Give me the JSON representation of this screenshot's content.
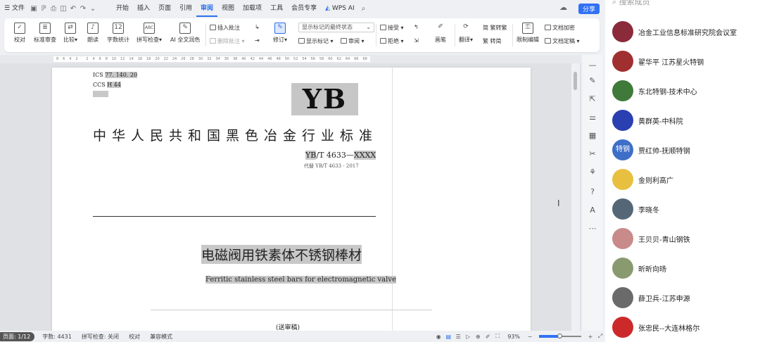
{
  "menubar": {
    "file": "文件",
    "undo_label": "↶",
    "tabs": [
      "开始",
      "插入",
      "页面",
      "引用",
      "审阅",
      "视图",
      "加载项",
      "工具",
      "会员专享"
    ],
    "active_tab": "审阅",
    "wps_ai": "WPS AI",
    "share": "分享"
  },
  "ribbon": {
    "proofread": "校对",
    "std_review": "标准审查",
    "compare": "比较",
    "read_aloud": "朗读",
    "word_count": "字数统计",
    "spell_check": "拼写检查",
    "ai_polish": "AI 全文润色",
    "insert_comment": "插入批注",
    "delete_comment": "删除批注",
    "revise": "修订",
    "display_dropdown": "显示标记的最终状态",
    "show_marks": "显示标记",
    "review_pane": "审阅",
    "accept": "接受",
    "reject": "拒绝",
    "pen": "画笔",
    "translate": "翻译",
    "trad_simp": "简 繁转繁",
    "simp_trad": "繁 转简",
    "restrict": "限制编辑",
    "doc_encrypt": "文档加密",
    "doc_final": "文档定稿"
  },
  "ruler": {
    "ticks": [
      "8",
      "6",
      "4",
      "2",
      "",
      "2",
      "4",
      "6",
      "8",
      "10",
      "12",
      "14",
      "16",
      "18",
      "20",
      "22",
      "24",
      "26",
      "28",
      "30",
      "32",
      "34",
      "36",
      "38",
      "40",
      "42",
      "44",
      "46",
      "48",
      "50",
      "52",
      "54",
      "56",
      "58",
      "60",
      "62",
      "64",
      "66",
      "68"
    ]
  },
  "document": {
    "ics_label": "ICS",
    "ics_value": "77. 140. 20",
    "ccs_label": "CCS",
    "ccs_value": "H 44",
    "logo": "YB",
    "title_cn": "中华人民共和国黑色冶金行业标准",
    "std_prefix": "YB",
    "std_number": "/T 4633—",
    "std_year": "XXXX",
    "replaces": "代替 YB/T 4633 - 2017",
    "doc_title": "电磁阀用铁素体不锈钢棒材",
    "doc_title_en": "Ferritic stainless steel bars for electromagnetic valve",
    "draft_note": "(送审稿)"
  },
  "status": {
    "page": "页面: 1/12",
    "word_count": "字数: 4431",
    "spell": "拼写检查: 关闭",
    "proofread": "校对",
    "compat": "兼容模式",
    "zoom": "93%",
    "zoom_fraction": 0.5
  },
  "chat": {
    "search_placeholder": "搜索成员",
    "members": [
      {
        "name": "冶金工业信息标准研究院会议室",
        "color": "#8a2a3a"
      },
      {
        "name": "翟华平 江苏星火特钢",
        "color": "#a03030"
      },
      {
        "name": "东北特钢-技术中心",
        "color": "#3f7a3a"
      },
      {
        "name": "黄群英-中科院",
        "color": "#2a3fb0"
      },
      {
        "name": "贾红帅-抚顺特钢",
        "color": "#3e6fc8",
        "text": "特钢"
      },
      {
        "name": "金则利高广",
        "color": "#e8c040"
      },
      {
        "name": "李晓冬",
        "color": "#556677"
      },
      {
        "name": "王贝贝-青山钢铁",
        "color": "#c98a8a"
      },
      {
        "name": "昕昕向旸",
        "color": "#8a9a70"
      },
      {
        "name": "薛卫兵-江苏申源",
        "color": "#6a6a6a"
      },
      {
        "name": "张忠民--大连林格尔",
        "color": "#cc2a2a"
      }
    ]
  }
}
